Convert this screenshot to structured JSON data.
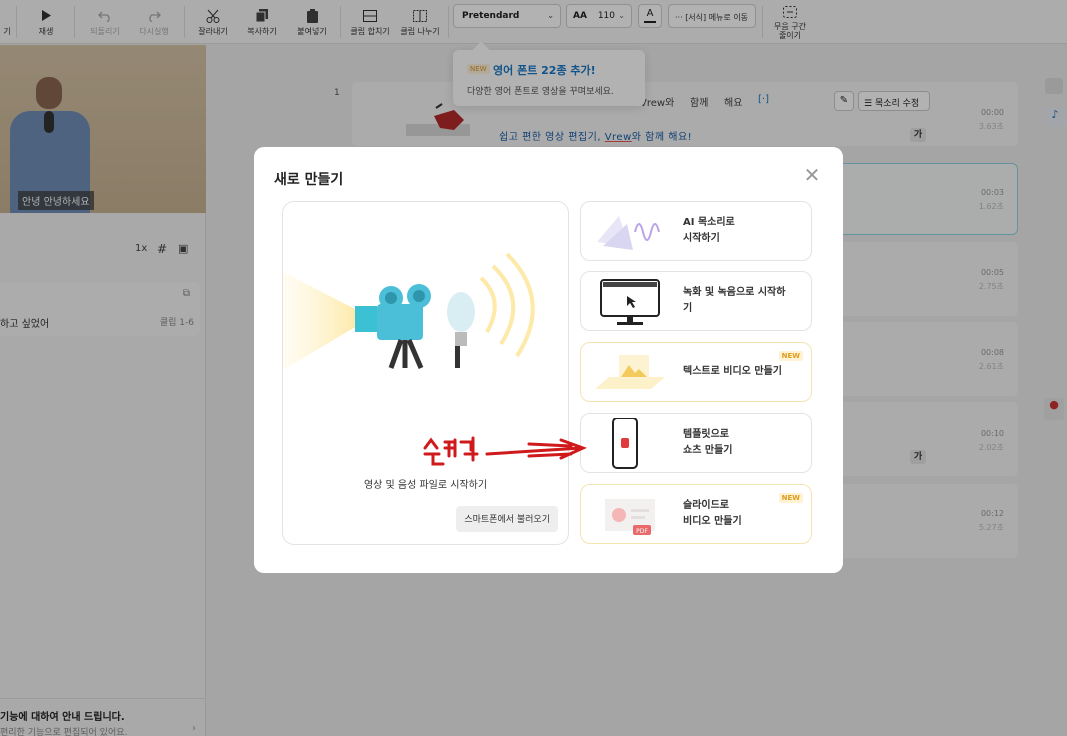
{
  "toolbar": {
    "items": [
      {
        "label": "기",
        "icon": "cut-partial-icon"
      },
      {
        "label": "재생",
        "icon": "play-icon"
      },
      {
        "label": "되돌리기",
        "icon": "undo-icon",
        "disabled": true
      },
      {
        "label": "다시실행",
        "icon": "redo-icon",
        "disabled": true
      },
      {
        "label": "잘라내기",
        "icon": "scissors-icon"
      },
      {
        "label": "복사하기",
        "icon": "copy-icon"
      },
      {
        "label": "붙여넣기",
        "icon": "paste-icon"
      },
      {
        "label": "클립 합치기",
        "icon": "merge-icon"
      },
      {
        "label": "클립 나누기",
        "icon": "split-icon"
      }
    ],
    "font_name": "Pretendard",
    "font_size_icon": "AA",
    "font_size": "110",
    "color_label": "A",
    "menu_move_label": "[서식] 메뉴로 이동",
    "menu_move_dots": "···",
    "silence_label": "무음 구간\n줄이기"
  },
  "tooltip": {
    "badge": "NEW",
    "title": "영어 폰트 22종 추가!",
    "subtitle": "다양한 영어 폰트로 영상을 꾸며보세요."
  },
  "left_panel": {
    "video_subtitle": "안녕 안녕하세요",
    "speed": "1x",
    "script_text": "하고 싶었어",
    "script_clip": "클립 1-6",
    "notice_title": "기능에 대하여 안내 드립니다.",
    "notice_sub": "편리한 기능으로 편집되어 있어요."
  },
  "editor": {
    "clip_number": "1",
    "words": [
      "Vrew와",
      "함께",
      "해요",
      "[·]"
    ],
    "subtitle_parts": [
      "쉽고 편한 영상 편집기, ",
      "Vrew",
      "와 함께 해요!"
    ],
    "edit_voice_label": "목소리 수정",
    "ga": "가",
    "rows": [
      {
        "time": "00:00",
        "dur": "3.63초"
      },
      {
        "time": "00:03",
        "dur": "1.62초"
      },
      {
        "time": "00:05",
        "dur": "2.75초"
      },
      {
        "time": "00:08",
        "dur": "2.61초"
      },
      {
        "time": "00:10",
        "dur": "2.02초"
      },
      {
        "time": "00:12",
        "dur": "5.27초"
      }
    ]
  },
  "modal": {
    "title": "새로 만들기",
    "big_card_label": "영상 및 음성 파일로 시작하기",
    "phone_load": "스마트폰에서 불러오기",
    "options": [
      {
        "label": "AI 목소리로\n시작하기",
        "new": false
      },
      {
        "label": "녹화 및 녹음으로 시작하\n기",
        "new": false
      },
      {
        "label": "텍스트로 비디오 만들기",
        "new": true,
        "badge": "NEW"
      },
      {
        "label": "템플릿으로\n쇼츠 만들기",
        "new": false
      },
      {
        "label": "슬라이드로\n비디오 만들기",
        "new": true,
        "badge": "NEW"
      }
    ],
    "pdf_label": "PDF"
  },
  "colors": {
    "accent_blue": "#1b78c4",
    "new_badge": "#e09b1b",
    "annotation_red": "#d0191b"
  }
}
